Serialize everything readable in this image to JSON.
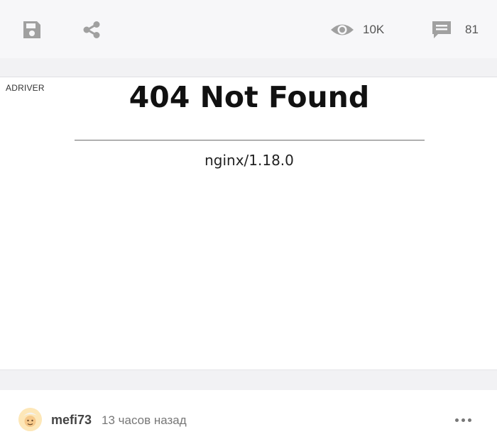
{
  "toolbar": {
    "save_icon": "floppy-disk-icon",
    "share_icon": "share-icon",
    "views_icon": "eye-icon",
    "views_count": "10K",
    "comments_icon": "comment-icon",
    "comments_count": "81"
  },
  "ad": {
    "label": "ADRIVER",
    "error_title": "404 Not Found",
    "server_signature": "nginx/1.18.0"
  },
  "author": {
    "avatar_icon": "avatar-icon",
    "name": "mefi73",
    "time": "13 часов назад",
    "more_icon": "more-dots-icon"
  },
  "colors": {
    "toolbar_bg": "#f7f7f9",
    "icon_gray": "#9a9a9a",
    "text_dark": "#111111"
  }
}
